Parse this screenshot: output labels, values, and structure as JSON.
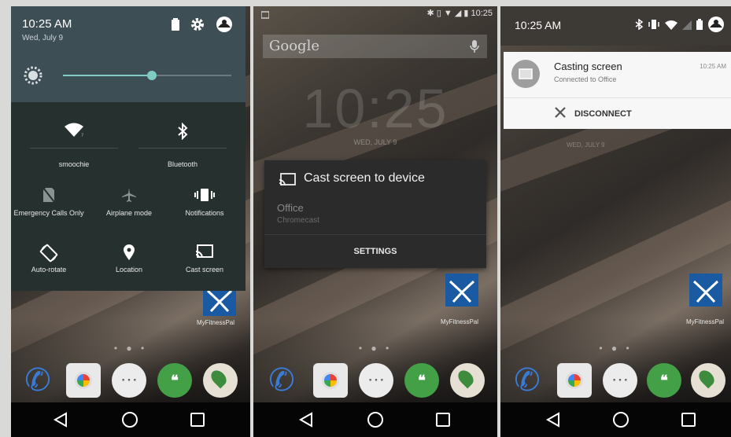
{
  "screen1": {
    "time": "10:25 AM",
    "date": "Wed, July 9",
    "brightness": 0.53,
    "tiles": [
      {
        "label": "smoochie",
        "icon": "wifi-icon"
      },
      {
        "label": "Bluetooth",
        "icon": "bluetooth-icon"
      },
      {
        "label": "Emergency Calls Only",
        "icon": "no-sim-icon"
      },
      {
        "label": "Airplane mode",
        "icon": "airplane-icon"
      },
      {
        "label": "Notifications",
        "icon": "vibrate-icon"
      },
      {
        "label": "Auto-rotate",
        "icon": "rotate-icon"
      },
      {
        "label": "Location",
        "icon": "location-pin-icon"
      },
      {
        "label": "Cast screen",
        "icon": "cast-icon"
      }
    ],
    "app_label": "MyFitnessPal"
  },
  "screen2": {
    "status_time": "10:25",
    "search_brand": "Google",
    "clock": "10:25",
    "date": "WED, JULY 9",
    "dialog": {
      "title": "Cast screen to device",
      "device_name": "Office",
      "device_type": "Chromecast",
      "settings_label": "SETTINGS"
    },
    "app_label": "MyFitnessPal"
  },
  "screen3": {
    "time": "10:25 AM",
    "notification": {
      "title": "Casting screen",
      "subtitle": "Connected to Office",
      "time": "10:25 AM",
      "action_label": "DISCONNECT"
    },
    "date": "WED, JULY 9",
    "app_label": "MyFitnessPal"
  },
  "colors": {
    "qs_header": "#3e4e55",
    "qs_panel": "#26302f",
    "accent_teal": "#80cbc4",
    "dialog_bg": "#2b2b2b",
    "notification_bg": "#f7f7f7"
  }
}
